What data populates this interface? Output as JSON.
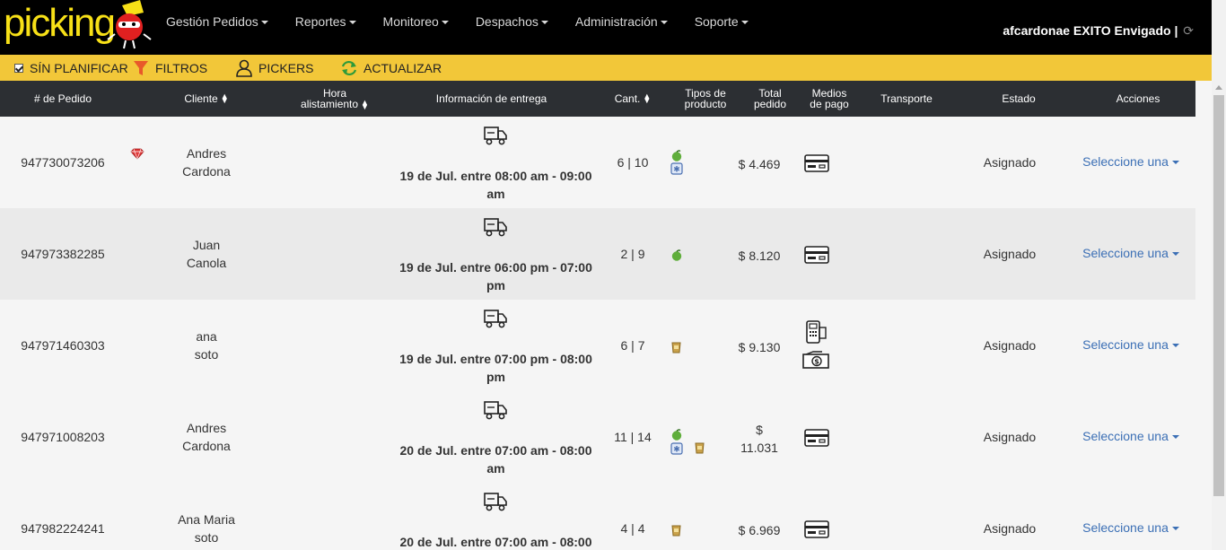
{
  "brand": {
    "logo": "picking"
  },
  "nav": [
    {
      "label": "Gestión Pedidos"
    },
    {
      "label": "Reportes"
    },
    {
      "label": "Monitoreo"
    },
    {
      "label": "Despachos"
    },
    {
      "label": "Administración"
    },
    {
      "label": "Soporte"
    }
  ],
  "user": {
    "label": "afcardonae EXITO Envigado |"
  },
  "toolbar": {
    "sin_planificar": "SÍN PLANIFICAR",
    "filtros": "FILTROS",
    "pickers": "PICKERS",
    "actualizar": "ACTUALIZAR"
  },
  "table": {
    "headers": {
      "pedido": "# de Pedido",
      "cliente": "Cliente",
      "hora_1": "Hora",
      "hora_2": "alistamiento",
      "entrega": "Información de entrega",
      "cant": "Cant.",
      "tipos_1": "Tipos de",
      "tipos_2": "producto",
      "total_1": "Total",
      "total_2": "pedido",
      "medios_1": "Medios",
      "medios_2": "de pago",
      "transporte": "Transporte",
      "estado": "Estado",
      "acciones": "Acciones"
    },
    "rows": [
      {
        "pedido": "947730073206",
        "cliente_1": "Andres",
        "cliente_2": "Cardona",
        "entrega_1": "19 de Jul. entre 08:00 am - 09:00",
        "entrega_2": "am",
        "cant": "6 | 10",
        "total_1": "$ 4.469",
        "total_2": "",
        "estado": "Asignado",
        "accion": "Seleccione una",
        "vip": true,
        "tipos": [
          "fruit-icon",
          "frozen-icon"
        ],
        "pago": [
          "card-icon"
        ]
      },
      {
        "pedido": "947973382285",
        "cliente_1": "Juan",
        "cliente_2": "Canola",
        "entrega_1": "19 de Jul. entre 06:00 pm - 07:00",
        "entrega_2": "pm",
        "cant": "2 | 9",
        "total_1": "$ 8.120",
        "total_2": "",
        "estado": "Asignado",
        "accion": "Seleccione una",
        "vip": false,
        "tipos": [
          "fruit-icon"
        ],
        "pago": [
          "card-icon"
        ]
      },
      {
        "pedido": "947971460303",
        "cliente_1": "ana",
        "cliente_2": "soto",
        "entrega_1": "19 de Jul. entre 07:00 pm - 08:00",
        "entrega_2": "pm",
        "cant": "6 | 7",
        "total_1": "$ 9.130",
        "total_2": "",
        "estado": "Asignado",
        "accion": "Seleccione una",
        "vip": false,
        "tipos": [
          "grocery-icon"
        ],
        "pago": [
          "dataphone-icon",
          "cash-icon"
        ]
      },
      {
        "pedido": "947971008203",
        "cliente_1": "Andres",
        "cliente_2": "Cardona",
        "entrega_1": "20 de Jul. entre 07:00 am - 08:00",
        "entrega_2": "am",
        "cant": "11 | 14",
        "total_1": "$",
        "total_2": "11.031",
        "estado": "Asignado",
        "accion": "Seleccione una",
        "vip": false,
        "tipos": [
          "fruit-icon",
          "frozen-icon",
          "grocery-icon"
        ],
        "pago": [
          "card-icon"
        ]
      },
      {
        "pedido": "947982224241",
        "cliente_1": "Ana Maria",
        "cliente_2": "soto",
        "entrega_1": "20 de Jul. entre 07:00 am - 08:00",
        "entrega_2": "",
        "cant": "4 | 4",
        "total_1": "$ 6.969",
        "total_2": "",
        "estado": "Asignado",
        "accion": "Seleccione una",
        "vip": false,
        "tipos": [
          "grocery-icon"
        ],
        "pago": [
          "card-icon"
        ]
      }
    ]
  },
  "colors": {
    "topbar": "#000000",
    "toolbar": "#f2c739",
    "header": "#2c2f33",
    "link": "#3b6fb5",
    "logo": "#f7e017"
  }
}
